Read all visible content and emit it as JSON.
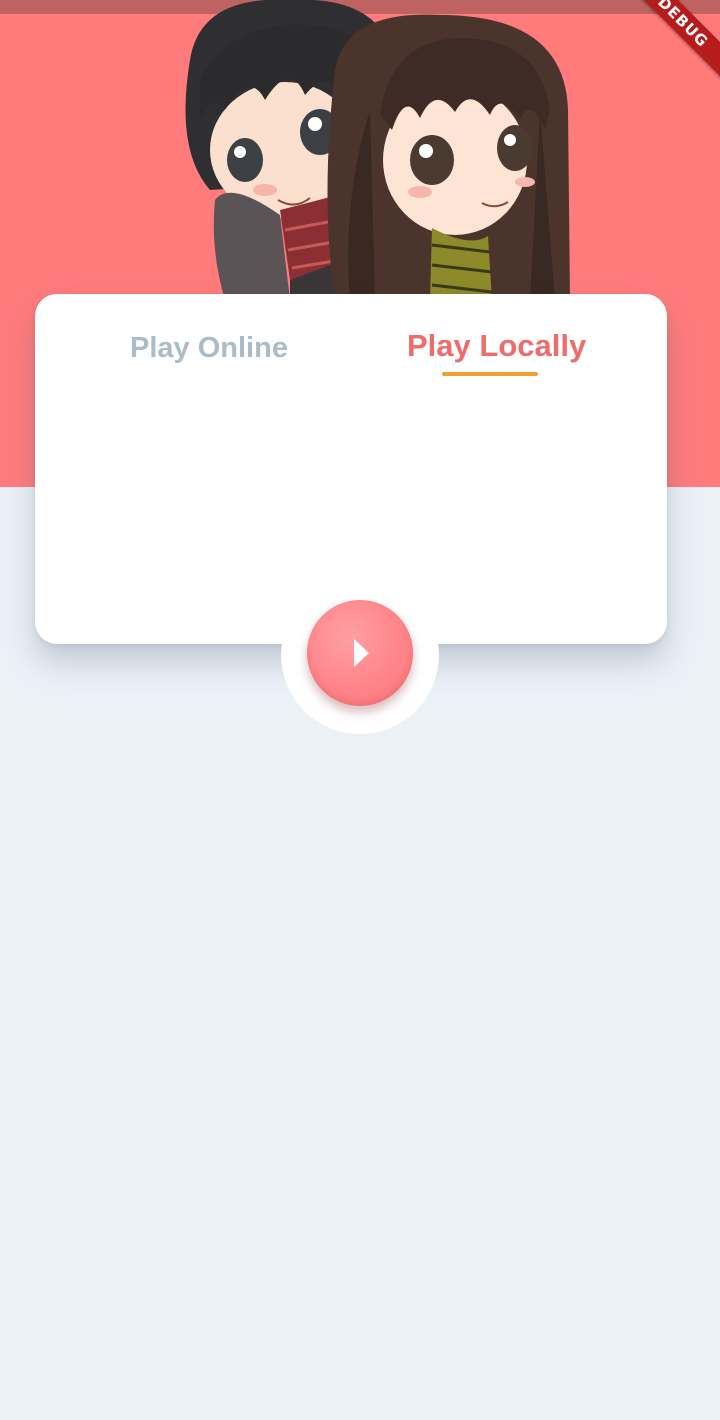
{
  "header": {
    "debug_banner": "DEBUG",
    "illustration_icon": "chibi-couple-illustration"
  },
  "tabs": [
    {
      "label": "Play Online",
      "selected": false
    },
    {
      "label": "Play Locally",
      "selected": true
    }
  ],
  "play_button": {
    "icon": "play-icon"
  },
  "colors": {
    "hero_background": "#ff7b7c",
    "page_background": "#ecf1f8",
    "tab_inactive": "#a9bcc8",
    "tab_active": "#ef6c6d",
    "tab_indicator": "#f0a030",
    "play_button": "#ff858a"
  }
}
